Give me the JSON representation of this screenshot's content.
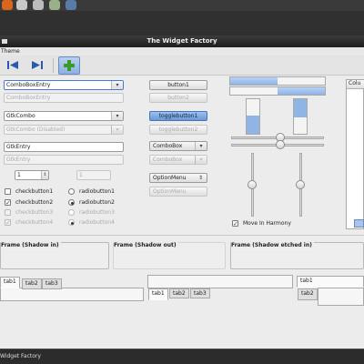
{
  "window": {
    "title": "The Widget Factory"
  },
  "menubar": {
    "theme_label": "Theme"
  },
  "toolbar": {
    "items": [
      "back-icon",
      "forward-icon",
      "add-icon"
    ]
  },
  "left": {
    "combo_entry": {
      "value": "ComboBoxEntry"
    },
    "combo_entry_dis": {
      "value": "ComboBoxEntry"
    },
    "gtk_combo": {
      "value": "GtkCombo"
    },
    "gtk_combo_dis": {
      "value": "GtkCombo (Disabled)"
    },
    "entry": {
      "value": "GtkEntry"
    },
    "entry_dis": {
      "value": "GtkEntry"
    },
    "spin": {
      "value": "1"
    },
    "spin_dis": {
      "value": "1"
    },
    "checks": [
      "checkbutton1",
      "checkbutton2",
      "checkbutton3",
      "checkbutton4"
    ],
    "radios": [
      "radiobutton1",
      "radiobutton2",
      "radiobutton3",
      "radiobutton4"
    ]
  },
  "middle": {
    "button1": "button1",
    "button2": "button2",
    "toggle1": "togglebutton1",
    "toggle2": "togglebutton2",
    "combobox": "ComboBox",
    "combobox_dis": "ComboBox",
    "optionmenu": "OptionMenu",
    "optionmenu_dis": "OptionMenu"
  },
  "right": {
    "move_harmony": "Move In Harmony",
    "list_header": "Colu"
  },
  "frames": [
    "Frame (Shadow in)",
    "Frame (Shadow out)",
    "Frame (Shadow etched in)"
  ],
  "tabs": {
    "set1": [
      "tab1",
      "tab2",
      "tab3"
    ],
    "set2": [
      "tab1",
      "tab2",
      "tab3"
    ],
    "set3": [
      "tab1",
      "tab2"
    ]
  },
  "statusbar": {
    "label": "Widget Factory"
  },
  "colors": {
    "accent": "#6a9ad8",
    "progress": "#8fb4e6"
  }
}
